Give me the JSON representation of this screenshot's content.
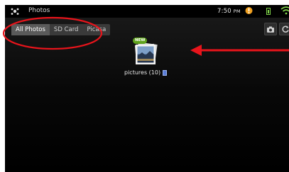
{
  "app": {
    "title": "Photos",
    "icon": "gallery-icon"
  },
  "status": {
    "time": "7:50",
    "ampm": "PM",
    "alert_icon": "alert-icon",
    "battery_icon": "battery-icon",
    "wifi_icon": "wifi-icon"
  },
  "tabs": [
    {
      "label": "All Photos",
      "selected": true
    },
    {
      "label": "SD Card",
      "selected": false
    },
    {
      "label": "Picasa",
      "selected": false
    }
  ],
  "toolbar": {
    "camera_icon": "camera-icon",
    "refresh_icon": "refresh-icon"
  },
  "album": {
    "badge": "NEW",
    "label": "pictures (10)",
    "source_icon": "sd-card-icon"
  },
  "colors": {
    "annotation": "#e8141b",
    "badge": "#5fa21e",
    "tab_selected": "#5a5a5a"
  }
}
